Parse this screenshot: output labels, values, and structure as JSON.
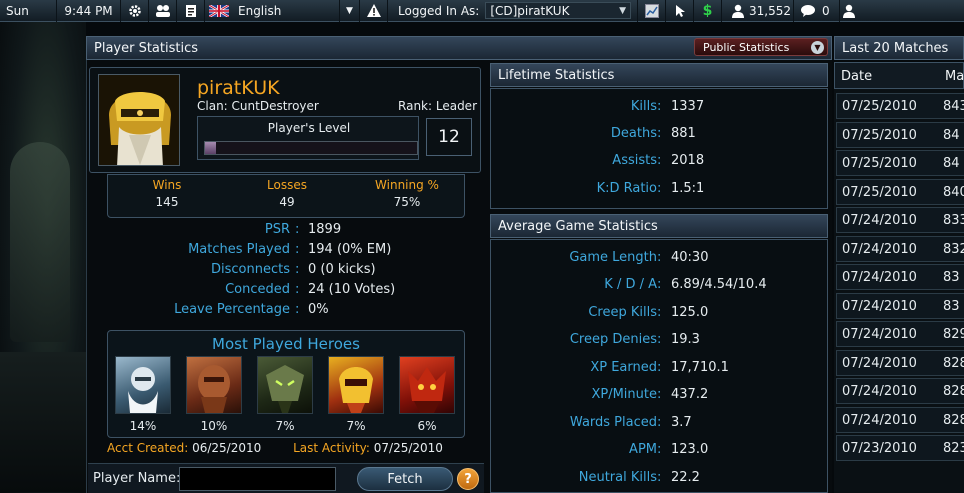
{
  "topbar": {
    "day": "Sun",
    "time": "9:44 PM",
    "language": "English",
    "logged_in_label": "Logged In As:",
    "account": "[CD]piratKUK",
    "players_online": "31,552",
    "messages_count": "0",
    "icons": [
      "gear-icon",
      "users-icon",
      "notes-icon",
      "uk-flag-icon",
      "warning-icon",
      "chart-icon",
      "pointer-icon",
      "dollar-icon",
      "person-icon",
      "chat-bubble-icon",
      "person-icon"
    ]
  },
  "player_statistics": {
    "title": "Player Statistics",
    "visibility_dropdown": "Public Statistics",
    "name": "piratKUK",
    "clan": "Clan: CuntDestroyer",
    "rank": "Rank: Leader",
    "level_label": "Player's Level",
    "level": "12",
    "level_progress": 0.05,
    "record": [
      {
        "label": "Wins",
        "value": "145"
      },
      {
        "label": "Losses",
        "value": "49"
      },
      {
        "label": "Winning %",
        "value": "75%"
      }
    ],
    "stats": [
      {
        "label": "PSR",
        "value": "1899"
      },
      {
        "label": "Matches Played",
        "value": "194 (0% EM)"
      },
      {
        "label": "Disconnects",
        "value": "0 (0 kicks)"
      },
      {
        "label": "Conceded",
        "value": "24 (10 Votes)"
      },
      {
        "label": "Leave Percentage",
        "value": "0%"
      }
    ],
    "most_played_title": "Most Played Heroes",
    "heroes": [
      {
        "name": "hero-1",
        "pct": "14%"
      },
      {
        "name": "hero-2",
        "pct": "10%"
      },
      {
        "name": "hero-3",
        "pct": "7%"
      },
      {
        "name": "hero-4",
        "pct": "7%"
      },
      {
        "name": "hero-5",
        "pct": "6%"
      }
    ],
    "acct_created_label": "Acct Created:",
    "acct_created": "06/25/2010",
    "last_activity_label": "Last Activity:",
    "last_activity": "07/25/2010",
    "player_name_label": "Player Name:",
    "player_name_value": "",
    "fetch_label": "Fetch",
    "help_label": "?"
  },
  "lifetime": {
    "title": "Lifetime Statistics",
    "rows": [
      {
        "label": "Kills",
        "value": "1337"
      },
      {
        "label": "Deaths",
        "value": "881"
      },
      {
        "label": "Assists",
        "value": "2018"
      },
      {
        "label": "K:D Ratio",
        "value": "1.5:1"
      }
    ]
  },
  "average": {
    "title": "Average Game Statistics",
    "rows": [
      {
        "label": "Game Length",
        "value": "40:30"
      },
      {
        "label": "K / D / A",
        "value": "6.89/4.54/10.4"
      },
      {
        "label": "Creep Kills",
        "value": "125.0"
      },
      {
        "label": "Creep Denies",
        "value": "19.3"
      },
      {
        "label": "XP Earned",
        "value": "17,710.1"
      },
      {
        "label": "XP/Minute",
        "value": "437.2"
      },
      {
        "label": "Wards Placed",
        "value": "3.7"
      },
      {
        "label": "APM",
        "value": "123.0"
      },
      {
        "label": "Neutral Kills",
        "value": "22.2"
      }
    ]
  },
  "last_matches": {
    "title": "Last 20 Matches",
    "col_date": "Date",
    "col_match": "Ma",
    "rows": [
      {
        "date": "07/25/2010",
        "match": "843"
      },
      {
        "date": "07/25/2010",
        "match": "84"
      },
      {
        "date": "07/25/2010",
        "match": "84"
      },
      {
        "date": "07/25/2010",
        "match": "840"
      },
      {
        "date": "07/24/2010",
        "match": "833"
      },
      {
        "date": "07/24/2010",
        "match": "832"
      },
      {
        "date": "07/24/2010",
        "match": "83"
      },
      {
        "date": "07/24/2010",
        "match": "83"
      },
      {
        "date": "07/24/2010",
        "match": "829"
      },
      {
        "date": "07/24/2010",
        "match": "828"
      },
      {
        "date": "07/24/2010",
        "match": "828"
      },
      {
        "date": "07/24/2010",
        "match": "828"
      },
      {
        "date": "07/23/2010",
        "match": "823"
      }
    ]
  }
}
